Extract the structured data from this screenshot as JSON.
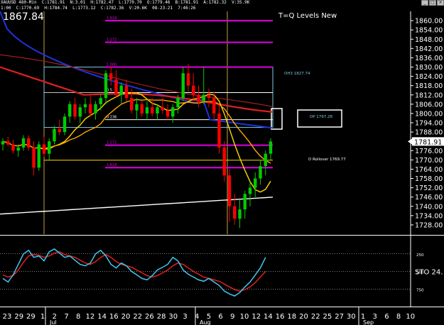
{
  "header": {
    "info_line1": "XAUUSD 480-Min  C:1781.91  N:3.01  H:1782.47  L:1770.70  O:1779.46  B:1781.91  A:1782.32  V:35.9K",
    "info_line2": "1:00  C:1770.69  H:1784.74  L:1773.12  C:1782.36  V:20.6K  08-23-21  7:46:26",
    "big_price": "1867.84",
    "study_title": "T=Q Levels New"
  },
  "chart_data": {
    "type": "candlestick",
    "title": "",
    "symbol": "XAUUSD",
    "interval": "480-Min",
    "last_price": 1781.91,
    "ylim": [
      1722,
      1866
    ],
    "y_ticks": [
      1728.0,
      1734.0,
      1740.0,
      1746.0,
      1752.0,
      1758.0,
      1764.0,
      1770.0,
      1776.0,
      1782.0,
      1788.0,
      1794.0,
      1800.0,
      1806.0,
      1812.0,
      1818.0,
      1824.0,
      1830.0,
      1836.0,
      1842.0,
      1848.0,
      1854.0,
      1860.0
    ],
    "x_labels": [
      "23",
      "29",
      "29",
      "1",
      "2",
      "7",
      "8",
      "12",
      "14",
      "16",
      "20",
      "22",
      "26",
      "28",
      "30",
      "3",
      "4",
      "5",
      "6",
      "9",
      "10",
      "12",
      "14",
      "16",
      "18",
      "20",
      "22",
      "25",
      "27",
      "30",
      "1",
      "3",
      "6",
      "8",
      "10"
    ],
    "month_labels": [
      "Jul",
      "Aug",
      "Sep"
    ],
    "levels": [
      {
        "label": "1.618",
        "price": 1860.0
      },
      {
        "label": "1.272",
        "price": 1846.0
      },
      {
        "label": "1.000",
        "price": 1830.0
      },
      {
        "label": "0.5",
        "price": 1813.5
      },
      {
        "label": "0.236",
        "price": 1796.0
      },
      {
        "label": "1.272",
        "price": 1779.5
      },
      {
        "label": "1.618",
        "price": 1765.0
      }
    ],
    "annotations": [
      {
        "text": "OH3 1827.74",
        "price": 1827.7
      },
      {
        "text": "DP 1797.28",
        "price": 1797.3
      },
      {
        "text": "D Rollover 1769.77",
        "price": 1769.8
      }
    ],
    "candles": [
      {
        "o": 1780,
        "h": 1784,
        "l": 1776,
        "c": 1782
      },
      {
        "o": 1782,
        "h": 1785,
        "l": 1779,
        "c": 1780
      },
      {
        "o": 1780,
        "h": 1783,
        "l": 1774,
        "c": 1776
      },
      {
        "o": 1776,
        "h": 1780,
        "l": 1772,
        "c": 1778
      },
      {
        "o": 1778,
        "h": 1786,
        "l": 1776,
        "c": 1784
      },
      {
        "o": 1784,
        "h": 1786,
        "l": 1776,
        "c": 1778
      },
      {
        "o": 1778,
        "h": 1782,
        "l": 1760,
        "c": 1765
      },
      {
        "o": 1765,
        "h": 1782,
        "l": 1763,
        "c": 1780
      },
      {
        "o": 1780,
        "h": 1785,
        "l": 1772,
        "c": 1774
      },
      {
        "o": 1774,
        "h": 1784,
        "l": 1770,
        "c": 1782
      },
      {
        "o": 1782,
        "h": 1792,
        "l": 1780,
        "c": 1790
      },
      {
        "o": 1790,
        "h": 1796,
        "l": 1786,
        "c": 1788
      },
      {
        "o": 1788,
        "h": 1800,
        "l": 1786,
        "c": 1798
      },
      {
        "o": 1798,
        "h": 1808,
        "l": 1794,
        "c": 1806
      },
      {
        "o": 1806,
        "h": 1810,
        "l": 1796,
        "c": 1798
      },
      {
        "o": 1798,
        "h": 1806,
        "l": 1794,
        "c": 1804
      },
      {
        "o": 1804,
        "h": 1810,
        "l": 1800,
        "c": 1806
      },
      {
        "o": 1806,
        "h": 1812,
        "l": 1798,
        "c": 1800
      },
      {
        "o": 1800,
        "h": 1808,
        "l": 1796,
        "c": 1806
      },
      {
        "o": 1806,
        "h": 1812,
        "l": 1802,
        "c": 1810
      },
      {
        "o": 1810,
        "h": 1828,
        "l": 1806,
        "c": 1826
      },
      {
        "o": 1826,
        "h": 1830,
        "l": 1818,
        "c": 1822
      },
      {
        "o": 1822,
        "h": 1828,
        "l": 1810,
        "c": 1812
      },
      {
        "o": 1812,
        "h": 1820,
        "l": 1806,
        "c": 1818
      },
      {
        "o": 1818,
        "h": 1822,
        "l": 1808,
        "c": 1810
      },
      {
        "o": 1810,
        "h": 1816,
        "l": 1800,
        "c": 1802
      },
      {
        "o": 1802,
        "h": 1810,
        "l": 1796,
        "c": 1806
      },
      {
        "o": 1806,
        "h": 1808,
        "l": 1798,
        "c": 1800
      },
      {
        "o": 1800,
        "h": 1808,
        "l": 1796,
        "c": 1804
      },
      {
        "o": 1804,
        "h": 1810,
        "l": 1798,
        "c": 1800
      },
      {
        "o": 1800,
        "h": 1806,
        "l": 1796,
        "c": 1804
      },
      {
        "o": 1804,
        "h": 1810,
        "l": 1800,
        "c": 1802
      },
      {
        "o": 1802,
        "h": 1806,
        "l": 1796,
        "c": 1798
      },
      {
        "o": 1798,
        "h": 1806,
        "l": 1794,
        "c": 1804
      },
      {
        "o": 1804,
        "h": 1812,
        "l": 1800,
        "c": 1810
      },
      {
        "o": 1810,
        "h": 1830,
        "l": 1808,
        "c": 1826
      },
      {
        "o": 1826,
        "h": 1832,
        "l": 1814,
        "c": 1818
      },
      {
        "o": 1818,
        "h": 1826,
        "l": 1808,
        "c": 1812
      },
      {
        "o": 1812,
        "h": 1818,
        "l": 1804,
        "c": 1808
      },
      {
        "o": 1808,
        "h": 1830,
        "l": 1806,
        "c": 1812
      },
      {
        "o": 1812,
        "h": 1816,
        "l": 1804,
        "c": 1810
      },
      {
        "o": 1810,
        "h": 1814,
        "l": 1796,
        "c": 1800
      },
      {
        "o": 1800,
        "h": 1806,
        "l": 1774,
        "c": 1778
      },
      {
        "o": 1778,
        "h": 1782,
        "l": 1756,
        "c": 1760
      },
      {
        "o": 1760,
        "h": 1764,
        "l": 1730,
        "c": 1740
      },
      {
        "o": 1740,
        "h": 1748,
        "l": 1728,
        "c": 1732
      },
      {
        "o": 1732,
        "h": 1744,
        "l": 1726,
        "c": 1738
      },
      {
        "o": 1738,
        "h": 1750,
        "l": 1732,
        "c": 1748
      },
      {
        "o": 1748,
        "h": 1756,
        "l": 1740,
        "c": 1752
      },
      {
        "o": 1752,
        "h": 1762,
        "l": 1746,
        "c": 1758
      },
      {
        "o": 1758,
        "h": 1770,
        "l": 1754,
        "c": 1766
      },
      {
        "o": 1766,
        "h": 1776,
        "l": 1760,
        "c": 1774
      },
      {
        "o": 1774,
        "h": 1784,
        "l": 1770,
        "c": 1781.9
      }
    ],
    "sto_label": "STO 24.",
    "sto_ticks": [
      "250",
      "500",
      "750"
    ],
    "sto_k": [
      40,
      35,
      45,
      60,
      75,
      80,
      70,
      72,
      65,
      78,
      82,
      76,
      70,
      72,
      66,
      60,
      58,
      62,
      75,
      80,
      72,
      60,
      55,
      62,
      58,
      50,
      45,
      40,
      38,
      44,
      52,
      56,
      60,
      70,
      65,
      52,
      46,
      42,
      38,
      36,
      40,
      35,
      30,
      22,
      18,
      15,
      20,
      28,
      35,
      45,
      55,
      70
    ],
    "sto_d": [
      45,
      42,
      44,
      52,
      63,
      72,
      74,
      73,
      70,
      72,
      76,
      78,
      74,
      72,
      70,
      66,
      62,
      60,
      64,
      70,
      74,
      70,
      64,
      60,
      58,
      56,
      52,
      48,
      44,
      42,
      44,
      48,
      52,
      58,
      62,
      60,
      55,
      50,
      46,
      42,
      40,
      38,
      36,
      32,
      28,
      24,
      22,
      24,
      28,
      34,
      42,
      50
    ],
    "colors": {
      "background": "#000000",
      "bull": "#00cc00",
      "bear": "#ff0000",
      "fib": "#e000e0",
      "ma_blue": "#1e32dc",
      "ma_red": "#e02020",
      "ma_dark_red": "#a02020",
      "ma_yellow": "#ffd800",
      "ma_orange": "#ffa500",
      "ma_white": "#ffffff",
      "range_box": "#7ec8e3",
      "sto_k": "#40c8f0",
      "sto_d": "#e02020"
    }
  }
}
